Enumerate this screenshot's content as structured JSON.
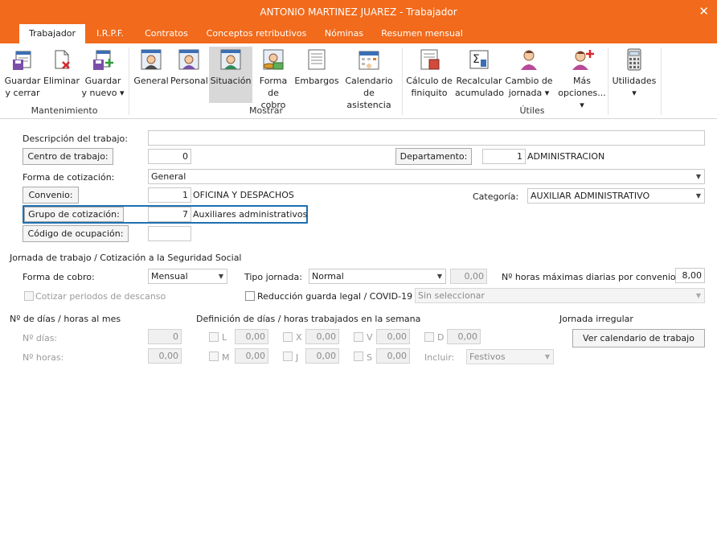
{
  "window": {
    "title": "ANTONIO MARTINEZ JUAREZ - Trabajador",
    "close_glyph": "✕"
  },
  "tabs": [
    "Trabajador",
    "I.R.P.F.",
    "Contratos",
    "Conceptos retributivos",
    "Nóminas",
    "Resumen mensual"
  ],
  "ribbon": {
    "guardar_cerrar": [
      "Guardar",
      "y cerrar"
    ],
    "eliminar": "Eliminar",
    "guardar_nuevo": [
      "Guardar",
      "y nuevo ▾"
    ],
    "general": "General",
    "personal": "Personal",
    "situacion": "Situación",
    "forma_cobro": [
      "Forma",
      "de cobro"
    ],
    "embargos": "Embargos",
    "calendario": [
      "Calendario",
      "de asistencia"
    ],
    "calculo_finiquito": [
      "Cálculo de",
      "finiquito"
    ],
    "recalcular": [
      "Recalcular",
      "acumulado"
    ],
    "cambio_jornada": [
      "Cambio de",
      "jornada ▾"
    ],
    "mas_opciones": [
      "Más",
      "opciones... ▾"
    ],
    "utilidades": [
      "Utilidades",
      "▾"
    ],
    "groups": {
      "mantenimiento": "Mantenimiento",
      "mostrar": "Mostrar",
      "utiles": "Útiles"
    }
  },
  "form": {
    "descripcion_label": "Descripción del trabajo:",
    "descripcion_value": "",
    "centro_button": "Centro de trabajo:",
    "centro_value": "0",
    "departamento_button": "Departamento:",
    "departamento_value": "1",
    "departamento_name": "ADMINISTRACION",
    "forma_cotizacion_label": "Forma de cotización:",
    "forma_cotizacion_value": "General",
    "convenio_button": "Convenio:",
    "convenio_value": "1",
    "convenio_name": "OFICINA Y DESPACHOS",
    "categoria_label": "Categoría:",
    "categoria_value": "AUXILIAR ADMINISTRATIVO",
    "grupo_button": "Grupo de cotización:",
    "grupo_value": "7",
    "grupo_name": "Auxiliares administrativos",
    "codigo_button": "Código de ocupación:",
    "codigo_value": ""
  },
  "jornada": {
    "section_title": "Jornada de trabajo / Cotización a la Seguridad Social",
    "forma_cobro_label": "Forma de cobro:",
    "forma_cobro_value": "Mensual",
    "tipo_jornada_label": "Tipo jornada:",
    "tipo_jornada_value": "Normal",
    "tipo_jornada_num": "0,00",
    "horas_max_label": "Nº horas máximas diarias por convenio:",
    "horas_max_value": "8,00",
    "cotizar_label": "Cotizar periodos de descanso",
    "reduccion_label": "Reducción guarda legal / COVID-19",
    "reduccion_select": "Sin seleccionar"
  },
  "dias": {
    "section_title": "Nº de días / horas al mes",
    "dias_label": "Nº días:",
    "dias_value": "0",
    "horas_label": "Nº horas:",
    "horas_value": "0,00"
  },
  "definicion": {
    "section_title": "Definición de días / horas trabajados en la semana",
    "days": [
      {
        "letter": "L",
        "value": "0,00"
      },
      {
        "letter": "X",
        "value": "0,00"
      },
      {
        "letter": "V",
        "value": "0,00"
      },
      {
        "letter": "D",
        "value": "0,00"
      },
      {
        "letter": "M",
        "value": "0,00"
      },
      {
        "letter": "J",
        "value": "0,00"
      },
      {
        "letter": "S",
        "value": "0,00"
      }
    ],
    "incluir_label": "Incluir:",
    "incluir_value": "Festivos"
  },
  "irregular": {
    "section_title": "Jornada irregular",
    "button": "Ver calendario de trabajo"
  },
  "colors": {
    "accent": "#f26a1b",
    "highlight": "#1e6fb0"
  }
}
